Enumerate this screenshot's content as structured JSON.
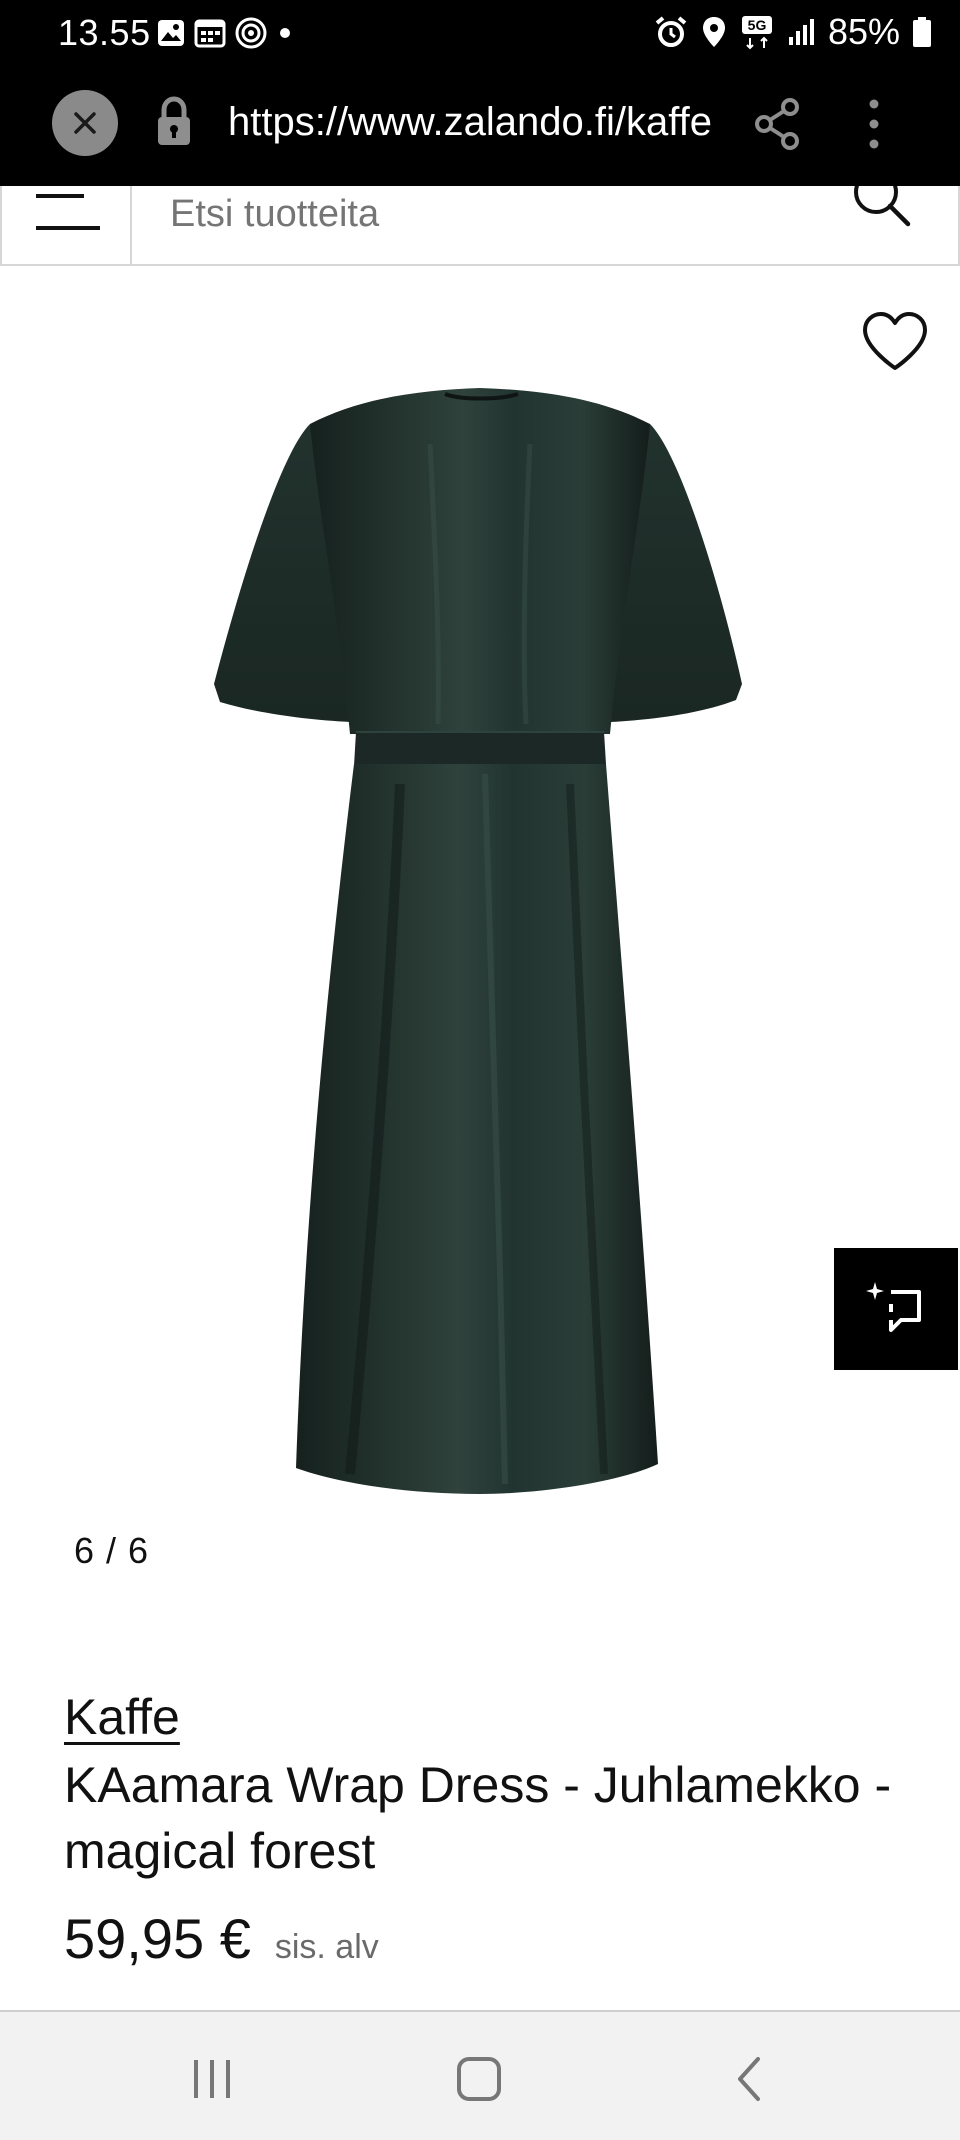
{
  "status_bar": {
    "time": "13.55",
    "battery": "85%",
    "network": "5G"
  },
  "browser": {
    "url": "https://www.zalando.fi/kaffe"
  },
  "search": {
    "placeholder": "Etsi tuotteita"
  },
  "gallery": {
    "counter": "6 / 6",
    "dress_color": "#1f2d29"
  },
  "product": {
    "brand": "Kaffe",
    "title": "KAamara Wrap Dress - Juhlamekko - magical forest",
    "price": "59,95 €",
    "vat_note": "sis. alv"
  },
  "icons": {
    "close": "close-icon",
    "lock": "lock-icon",
    "share": "share-icon",
    "menu": "more-vert-icon",
    "hamburger": "hamburger-icon",
    "search": "search-icon",
    "wishlist": "heart-icon",
    "compare": "compare-sparkle-icon"
  }
}
